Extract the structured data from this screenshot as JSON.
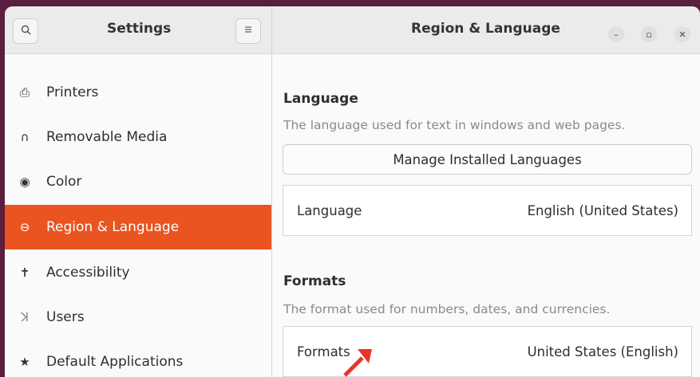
{
  "window": {
    "sidebar_title": "Settings",
    "panel_title": "Region & Language"
  },
  "sidebar": {
    "items": [
      {
        "label": "Printers",
        "icon": "printer-icon"
      },
      {
        "label": "Removable Media",
        "icon": "removable-media-icon"
      },
      {
        "label": "Color",
        "icon": "color-icon"
      },
      {
        "label": "Region & Language",
        "icon": "region-icon",
        "active": true
      },
      {
        "label": "Accessibility",
        "icon": "accessibility-icon"
      },
      {
        "label": "Users",
        "icon": "users-icon"
      },
      {
        "label": "Default Applications",
        "icon": "star-icon"
      }
    ]
  },
  "language": {
    "heading": "Language",
    "description": "The language used for text in windows and web pages.",
    "manage_button": "Manage Installed Languages",
    "row_label": "Language",
    "row_value": "English (United States)"
  },
  "formats": {
    "heading": "Formats",
    "description": "The format used for numbers, dates, and currencies.",
    "row_label": "Formats",
    "row_value": "United States (English)"
  },
  "colors": {
    "accent": "#e95420",
    "arrow": "#e8332a"
  }
}
